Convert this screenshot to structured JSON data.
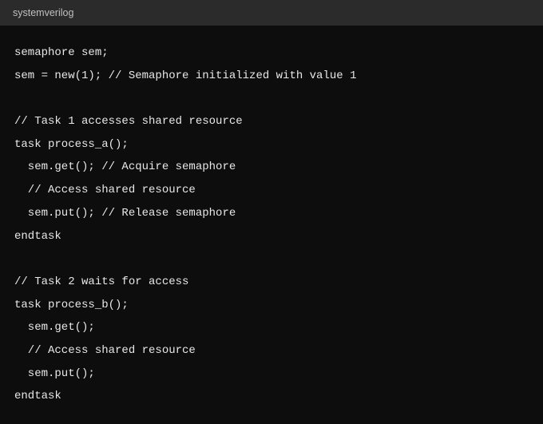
{
  "header": {
    "language": "systemverilog"
  },
  "code": {
    "lines": [
      "semaphore sem;",
      "sem = new(1); // Semaphore initialized with value 1",
      "",
      "// Task 1 accesses shared resource",
      "task process_a();",
      "  sem.get(); // Acquire semaphore",
      "  // Access shared resource",
      "  sem.put(); // Release semaphore",
      "endtask",
      "",
      "// Task 2 waits for access",
      "task process_b();",
      "  sem.get();",
      "  // Access shared resource",
      "  sem.put();",
      "endtask"
    ]
  }
}
